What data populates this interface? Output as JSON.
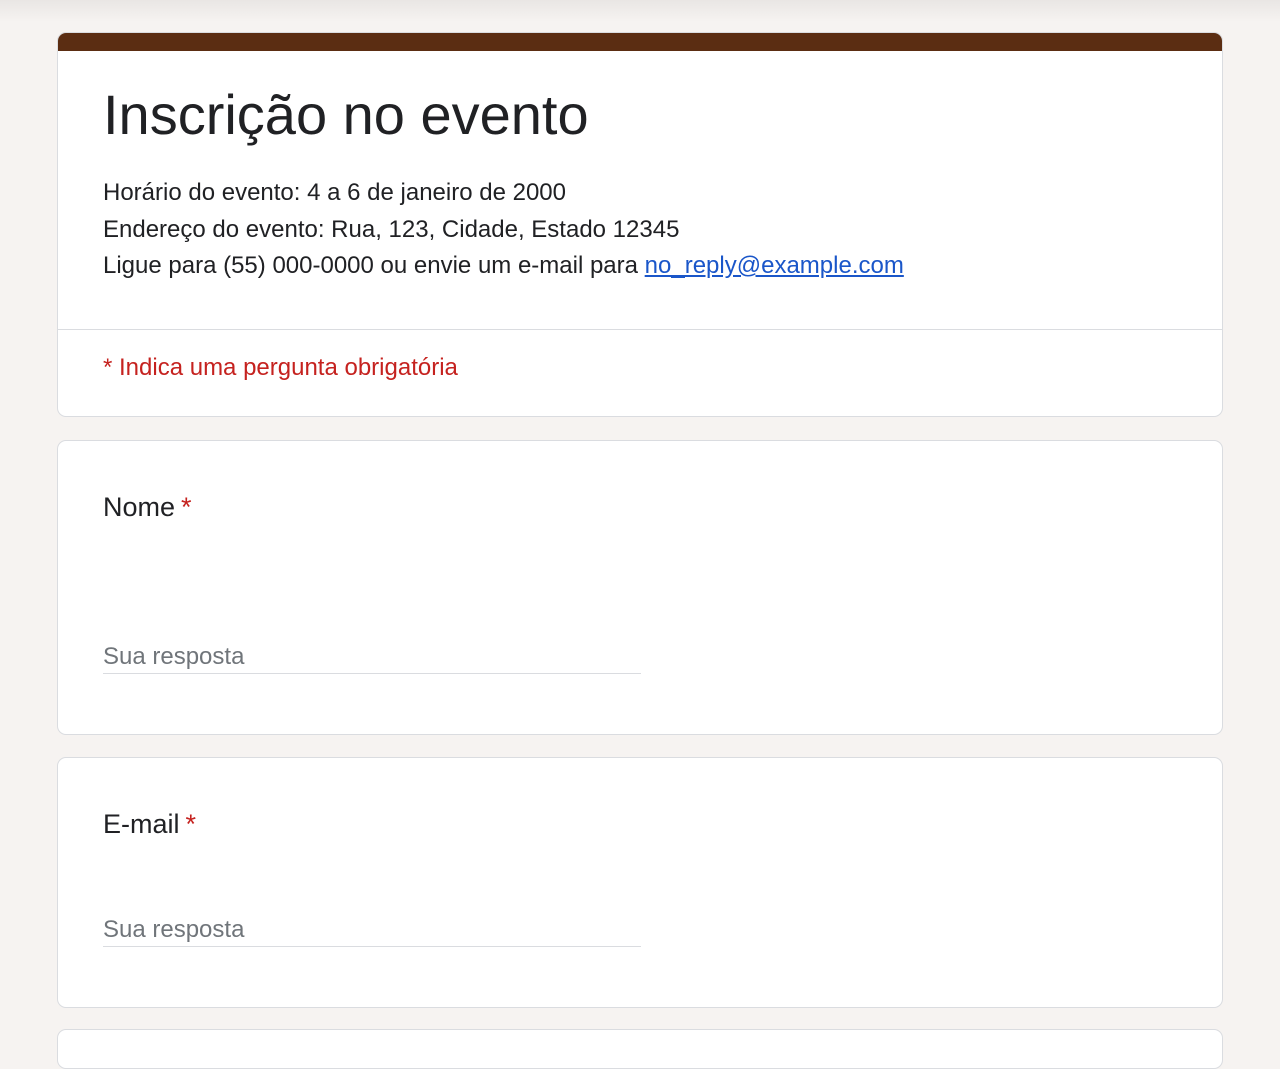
{
  "form": {
    "title": "Inscrição no evento",
    "description": {
      "line1": "Horário do evento: 4 a 6 de janeiro de 2000",
      "line2": "Endereço do evento: Rua, 123, Cidade, Estado 12345",
      "line3_prefix": "Ligue para (55) 000-0000 ou envie um e-mail para ",
      "email_link": "no_reply@example.com"
    },
    "required_note": "* Indica uma pergunta obrigatória"
  },
  "questions": [
    {
      "label": "Nome",
      "required_marker": "*",
      "placeholder": "Sua resposta"
    },
    {
      "label": "E-mail",
      "required_marker": "*",
      "placeholder": "Sua resposta"
    }
  ],
  "colors": {
    "accent": "#5b2d12",
    "background": "#f6f3f1",
    "required": "#c5221f",
    "link": "#1a56c9"
  }
}
